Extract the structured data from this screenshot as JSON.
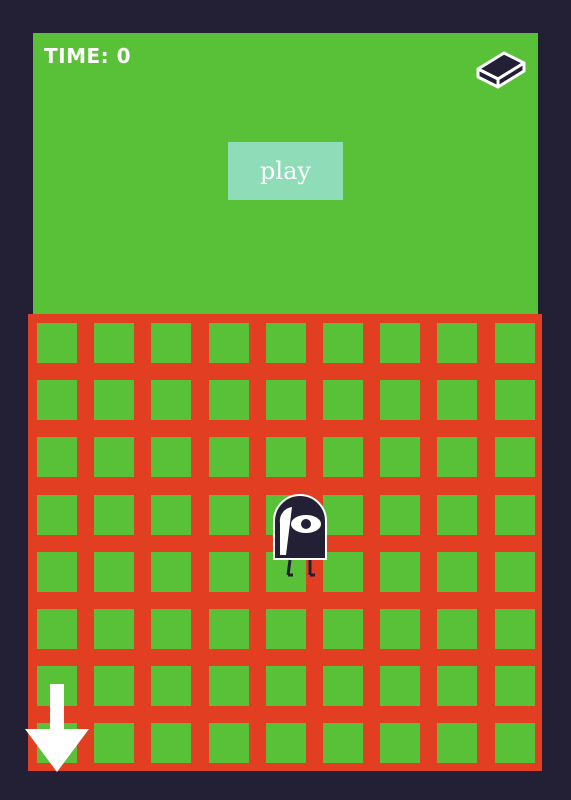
{
  "game": {
    "timer_label": "TIME: 0",
    "play_label": "play"
  },
  "grid": {
    "rows": 8,
    "cols": 9,
    "cell_color": "#59c137",
    "line_color": "#e23e21"
  },
  "icons": {
    "top_right": "eraser-icon",
    "bottom_left": "down-arrow-icon",
    "player": "one-eyed-ghost-character"
  },
  "colors": {
    "background": "#231f35",
    "field": "#59c137",
    "grid_lines": "#e23e21",
    "button": "#8fddb8",
    "character_body": "#231f35"
  }
}
